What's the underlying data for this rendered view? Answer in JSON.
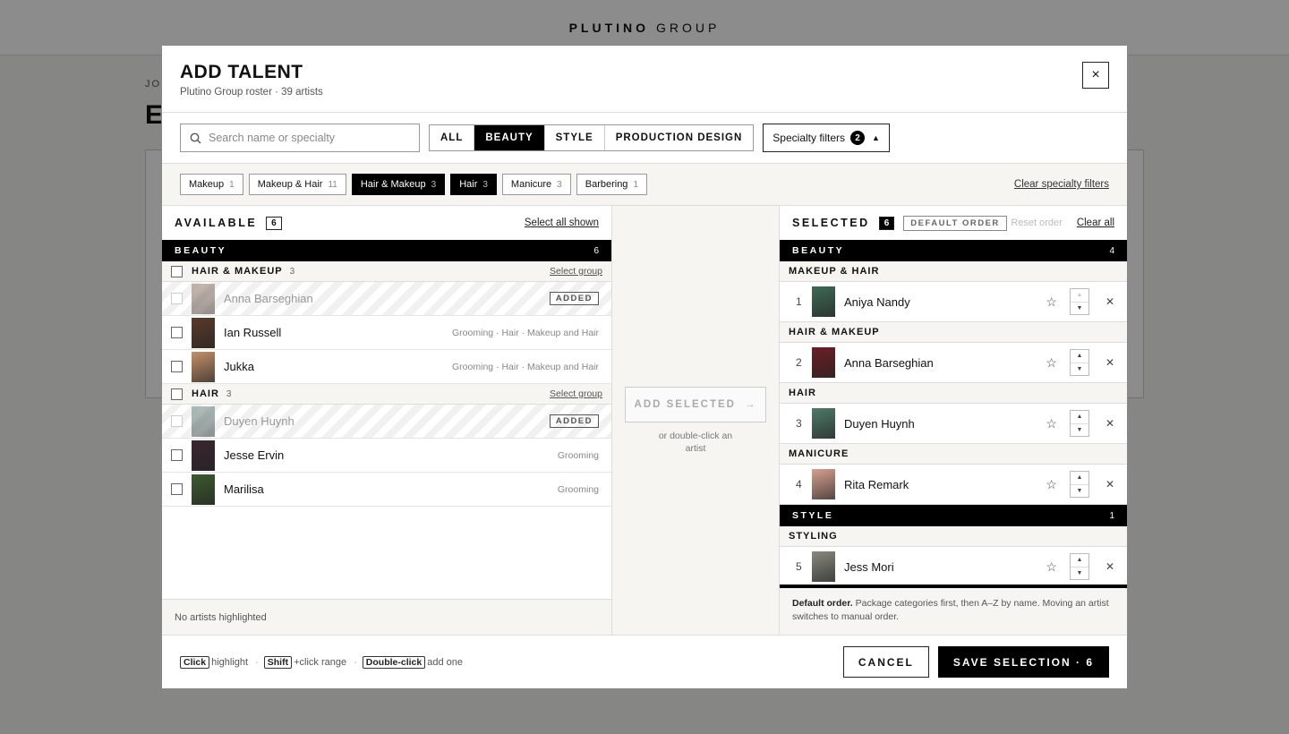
{
  "background": {
    "brand_bold": "PLUTINO",
    "brand_light": "GROUP",
    "crumb": "JO",
    "title_initial": "E"
  },
  "modal": {
    "title": "ADD TALENT",
    "subtitle": "Plutino Group roster · 39 artists",
    "close_icon": "×"
  },
  "toolbar": {
    "search_placeholder": "Search name or specialty",
    "tabs": [
      "ALL",
      "BEAUTY",
      "STYLE",
      "PRODUCTION DESIGN"
    ],
    "active_tab": "BEAUTY",
    "specialty_label": "Specialty filters",
    "specialty_count": "2"
  },
  "chips": [
    {
      "label": "Makeup",
      "count": "1",
      "on": false
    },
    {
      "label": "Makeup & Hair",
      "count": "11",
      "on": false
    },
    {
      "label": "Hair & Makeup",
      "count": "3",
      "on": true
    },
    {
      "label": "Hair",
      "count": "3",
      "on": true
    },
    {
      "label": "Manicure",
      "count": "3",
      "on": false
    },
    {
      "label": "Barbering",
      "count": "1",
      "on": false
    }
  ],
  "clear_specialty": "Clear specialty filters",
  "available": {
    "title": "AVAILABLE",
    "count": "6",
    "select_all": "Select all shown",
    "category": {
      "label": "BEAUTY",
      "count": "6"
    },
    "groups": [
      {
        "label": "HAIR & MAKEUP",
        "count": "3",
        "select": "Select group",
        "artists": [
          {
            "name": "Anna Barseghian",
            "added": true,
            "tags": "",
            "color": "#a08070"
          },
          {
            "name": "Ian Russell",
            "added": false,
            "tags": "Grooming · Hair · Makeup and Hair",
            "color": "#5a3a2a"
          },
          {
            "name": "Jukka",
            "added": false,
            "tags": "Grooming · Hair · Makeup and Hair",
            "color": "#c4906a"
          }
        ]
      },
      {
        "label": "HAIR",
        "count": "3",
        "select": "Select group",
        "artists": [
          {
            "name": "Duyen Huynh",
            "added": true,
            "tags": "",
            "color": "#6f8f8a"
          },
          {
            "name": "Jesse Ervin",
            "added": false,
            "tags": "Grooming",
            "color": "#3a2630"
          },
          {
            "name": "Marilisa",
            "added": false,
            "tags": "Grooming",
            "color": "#3d5a30"
          }
        ]
      }
    ],
    "added_label": "ADDED",
    "footer": "No artists highlighted"
  },
  "middle": {
    "add_label": "ADD SELECTED",
    "arrow": "→",
    "hint": "or double-click an artist"
  },
  "selected": {
    "title": "SELECTED",
    "count": "6",
    "default_order": "DEFAULT ORDER",
    "reset": "Reset order",
    "clear": "Clear all",
    "cat_beauty": {
      "label": "BEAUTY",
      "count": "4"
    },
    "cat_style": {
      "label": "STYLE",
      "count": "1"
    },
    "rows": [
      {
        "group": "MAKEUP & HAIR",
        "num": "1",
        "name": "Aniya Nandy",
        "color": "#3f6a55"
      },
      {
        "group": "HAIR & MAKEUP",
        "num": "2",
        "name": "Anna Barseghian",
        "color": "#6b1f24"
      },
      {
        "group": "HAIR",
        "num": "3",
        "name": "Duyen Huynh",
        "color": "#4f7a6a"
      },
      {
        "group": "MANICURE",
        "num": "4",
        "name": "Rita Remark",
        "color": "#d8a090"
      },
      {
        "group": "STYLING",
        "num": "5",
        "name": "Jess Mori",
        "color": "#8a8a80"
      }
    ],
    "footer_bold": "Default order.",
    "footer_text": " Package categories first, then A–Z by name. Moving an artist switches to manual order."
  },
  "footer": {
    "k1": "Click",
    "t1": "highlight",
    "k2": "Shift",
    "t2": "+click range",
    "k3": "Double-click",
    "t3": "add one",
    "cancel": "CANCEL",
    "save": "SAVE SELECTION · 6"
  }
}
